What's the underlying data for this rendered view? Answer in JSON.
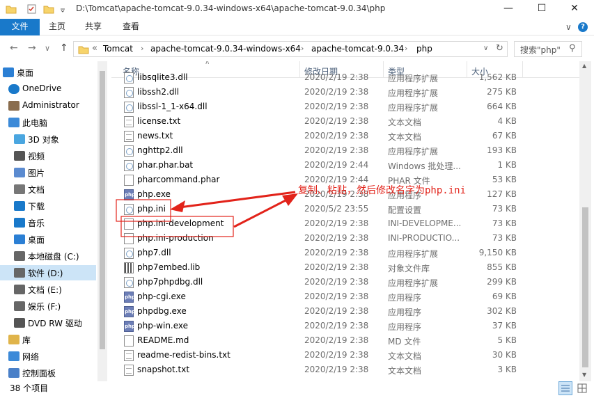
{
  "window": {
    "title": "D:\\Tomcat\\apache-tomcat-9.0.34-windows-x64\\apache-tomcat-9.0.34\\php",
    "minimize": "—",
    "maximize": "☐",
    "close": "✕"
  },
  "ribbon": {
    "tabs": [
      "文件",
      "主页",
      "共享",
      "查看"
    ],
    "expand": "∨",
    "help": "?"
  },
  "address": {
    "back": "←",
    "forward": "→",
    "recent": "∨",
    "up": "↑",
    "overflow": "«",
    "crumbs": [
      "Tomcat",
      "apache-tomcat-9.0.34-windows-x64",
      "apache-tomcat-9.0.34",
      "php"
    ],
    "refresh": "↻",
    "search_placeholder": "搜索\"php\""
  },
  "nav": {
    "items": [
      {
        "label": "桌面",
        "icon": "desktop-icon"
      },
      {
        "label": "OneDrive",
        "icon": "cloud-icon"
      },
      {
        "label": "Administrator",
        "icon": "user-icon"
      },
      {
        "label": "此电脑",
        "icon": "computer-icon"
      },
      {
        "label": "3D 对象",
        "icon": "cube-icon"
      },
      {
        "label": "视频",
        "icon": "video-icon"
      },
      {
        "label": "图片",
        "icon": "picture-icon"
      },
      {
        "label": "文档",
        "icon": "document-icon"
      },
      {
        "label": "下载",
        "icon": "download-icon"
      },
      {
        "label": "音乐",
        "icon": "music-icon"
      },
      {
        "label": "桌面",
        "icon": "desktop-icon"
      },
      {
        "label": "本地磁盘 (C:)",
        "icon": "drive-icon"
      },
      {
        "label": "软件 (D:)",
        "icon": "drive-icon"
      },
      {
        "label": "文档 (E:)",
        "icon": "drive-icon"
      },
      {
        "label": "娱乐 (F:)",
        "icon": "drive-icon"
      },
      {
        "label": "DVD RW 驱动",
        "icon": "dvd-icon"
      },
      {
        "label": "库",
        "icon": "library-icon"
      },
      {
        "label": "网络",
        "icon": "network-icon"
      },
      {
        "label": "控制面板",
        "icon": "control-panel-icon"
      }
    ]
  },
  "columns": {
    "name": "名称",
    "date": "修改日期",
    "type": "类型",
    "size": "大小",
    "sort_indicator": "∧"
  },
  "files": [
    {
      "name": "libsqlite3.dll",
      "date": "2020/2/19 2:38",
      "type": "应用程序扩展",
      "size": "1,562 KB",
      "icon": "dll"
    },
    {
      "name": "libssh2.dll",
      "date": "2020/2/19 2:38",
      "type": "应用程序扩展",
      "size": "275 KB",
      "icon": "dll"
    },
    {
      "name": "libssl-1_1-x64.dll",
      "date": "2020/2/19 2:38",
      "type": "应用程序扩展",
      "size": "664 KB",
      "icon": "dll"
    },
    {
      "name": "license.txt",
      "date": "2020/2/19 2:38",
      "type": "文本文档",
      "size": "4 KB",
      "icon": "txt"
    },
    {
      "name": "news.txt",
      "date": "2020/2/19 2:38",
      "type": "文本文档",
      "size": "67 KB",
      "icon": "txt"
    },
    {
      "name": "nghttp2.dll",
      "date": "2020/2/19 2:38",
      "type": "应用程序扩展",
      "size": "193 KB",
      "icon": "dll"
    },
    {
      "name": "phar.phar.bat",
      "date": "2020/2/19 2:44",
      "type": "Windows 批处理...",
      "size": "1 KB",
      "icon": "dll"
    },
    {
      "name": "pharcommand.phar",
      "date": "2020/2/19 2:44",
      "type": "PHAR 文件",
      "size": "53 KB",
      "icon": "file"
    },
    {
      "name": "php.exe",
      "date": "2020/2/19 2:38",
      "type": "应用程序",
      "size": "127 KB",
      "icon": "php"
    },
    {
      "name": "php.ini",
      "date": "2020/5/2 23:55",
      "type": "配置设置",
      "size": "73 KB",
      "icon": "dll"
    },
    {
      "name": "php.ini-development",
      "date": "2020/2/19 2:38",
      "type": "INI-DEVELOPME...",
      "size": "73 KB",
      "icon": "file"
    },
    {
      "name": "php.ini-production",
      "date": "2020/2/19 2:38",
      "type": "INI-PRODUCTIO...",
      "size": "73 KB",
      "icon": "file"
    },
    {
      "name": "php7.dll",
      "date": "2020/2/19 2:38",
      "type": "应用程序扩展",
      "size": "9,150 KB",
      "icon": "dll"
    },
    {
      "name": "php7embed.lib",
      "date": "2020/2/19 2:38",
      "type": "对象文件库",
      "size": "855 KB",
      "icon": "lib"
    },
    {
      "name": "php7phpdbg.dll",
      "date": "2020/2/19 2:38",
      "type": "应用程序扩展",
      "size": "299 KB",
      "icon": "dll"
    },
    {
      "name": "php-cgi.exe",
      "date": "2020/2/19 2:38",
      "type": "应用程序",
      "size": "69 KB",
      "icon": "php"
    },
    {
      "name": "phpdbg.exe",
      "date": "2020/2/19 2:38",
      "type": "应用程序",
      "size": "302 KB",
      "icon": "php"
    },
    {
      "name": "php-win.exe",
      "date": "2020/2/19 2:38",
      "type": "应用程序",
      "size": "37 KB",
      "icon": "php"
    },
    {
      "name": "README.md",
      "date": "2020/2/19 2:38",
      "type": "MD 文件",
      "size": "5 KB",
      "icon": "file"
    },
    {
      "name": "readme-redist-bins.txt",
      "date": "2020/2/19 2:38",
      "type": "文本文档",
      "size": "30 KB",
      "icon": "txt"
    },
    {
      "name": "snapshot.txt",
      "date": "2020/2/19 2:38",
      "type": "文本文档",
      "size": "3 KB",
      "icon": "txt"
    }
  ],
  "status": {
    "count": "38 个项目"
  },
  "annotation": {
    "text": "复制、粘贴，然后修改名字为php.ini",
    "color": "#e2231a"
  },
  "colors": {
    "accent": "#1979ca",
    "selected": "#cce4f7"
  }
}
